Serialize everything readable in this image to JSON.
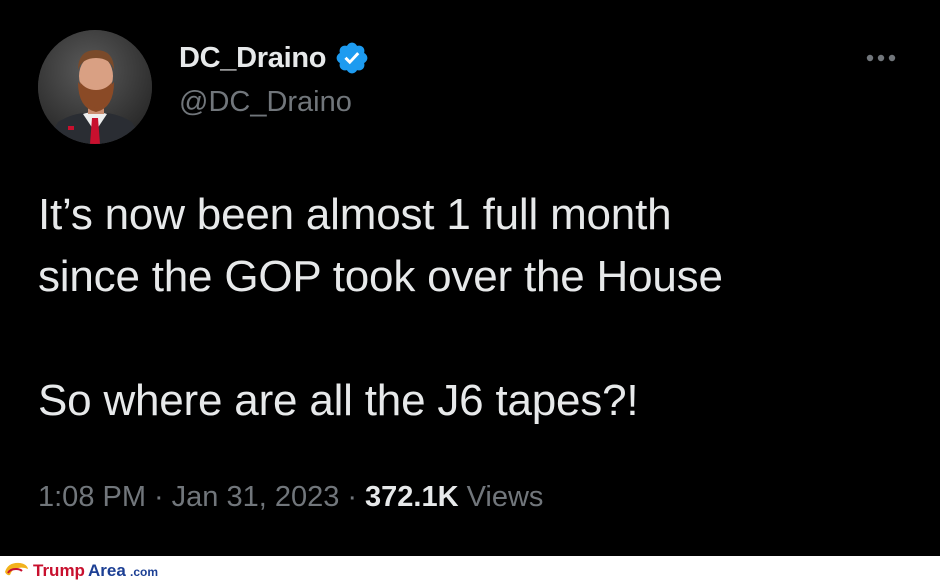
{
  "tweet": {
    "author": {
      "display_name": "DC_Draino",
      "handle": "@DC_Draino",
      "verified": true,
      "avatar_icon": "profile-photo"
    },
    "more_icon": "ellipsis-icon",
    "text": "It’s now been almost 1 full month\nsince the GOP took over the House\n\nSo where are all the J6 tapes?!",
    "meta": {
      "time": "1:08 PM",
      "separator": "·",
      "date": "Jan 31, 2023",
      "views_count": "372.1K",
      "views_label": "Views"
    }
  },
  "watermark": {
    "text": "TrumpArea.com"
  },
  "colors": {
    "background": "#000000",
    "text_primary": "#e7e9ea",
    "text_secondary": "#71767b",
    "verified_blue": "#1d9bf0",
    "watermark_red": "#c8102e",
    "watermark_blue": "#1c3f94"
  }
}
